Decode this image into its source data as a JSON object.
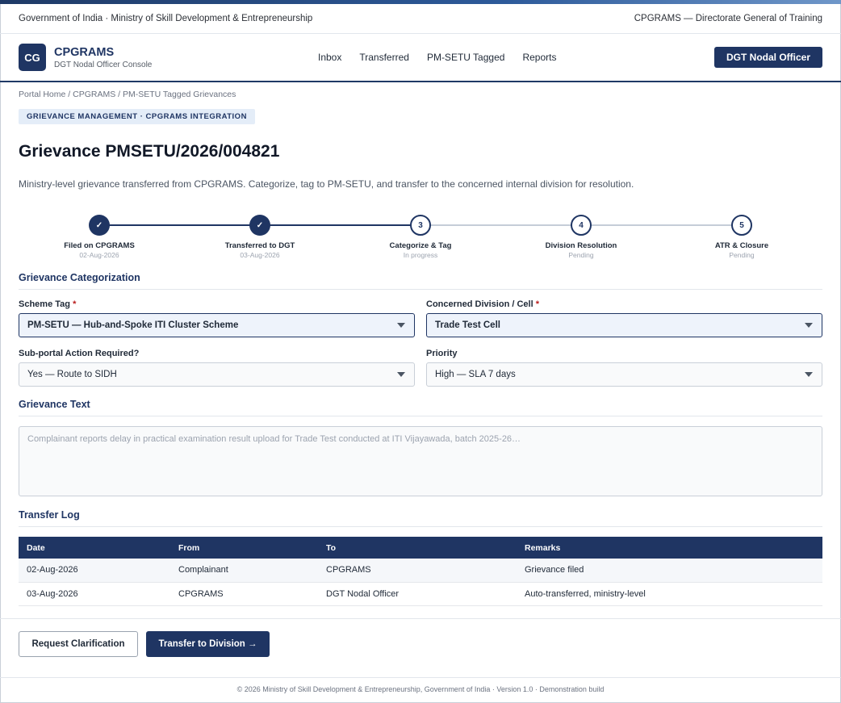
{
  "gov_bar": {
    "left": "Government of India · Ministry of Skill Development & Entrepreneurship",
    "right": "CPGRAMS — Directorate General of Training"
  },
  "header": {
    "logo_text": "CG",
    "title": "CPGRAMS",
    "subtitle": "DGT Nodal Officer Console",
    "nav": [
      "Inbox",
      "Transferred",
      "PM-SETU Tagged",
      "Reports"
    ],
    "role_button": "DGT Nodal Officer"
  },
  "breadcrumb": "Portal Home / CPGRAMS / PM-SETU Tagged Grievances",
  "section_chip": "GRIEVANCE MANAGEMENT · CPGRAMS INTEGRATION",
  "page_title": "Grievance PMSETU/2026/004821",
  "description": "Ministry-level grievance transferred from CPGRAMS. Categorize, tag to PM-SETU, and transfer to the concerned internal division for resolution.",
  "steps": [
    {
      "num": "✓",
      "label": "Filed on CPGRAMS",
      "sub": "02-Aug-2026",
      "state": "done"
    },
    {
      "num": "✓",
      "label": "Transferred to DGT",
      "sub": "03-Aug-2026",
      "state": "done"
    },
    {
      "num": "3",
      "label": "Categorize & Tag",
      "sub": "In progress",
      "state": "open"
    },
    {
      "num": "4",
      "label": "Division Resolution",
      "sub": "Pending",
      "state": "open"
    },
    {
      "num": "5",
      "label": "ATR & Closure",
      "sub": "Pending",
      "state": "open"
    }
  ],
  "categorization": {
    "heading": "Grievance Categorization",
    "scheme_label": "Scheme Tag",
    "scheme_value": "PM-SETU — Hub-and-Spoke ITI Cluster Scheme",
    "division_label": "Concerned Division / Cell",
    "division_value": "Trade Test Cell",
    "subportal_label": "Sub-portal Action Required?",
    "subportal_value": "Yes — Route to SIDH",
    "priority_label": "Priority",
    "priority_value": "High — SLA 7 days",
    "required_mark": "*"
  },
  "grievance_text": {
    "heading": "Grievance Text",
    "placeholder": "Complainant reports delay in practical examination result upload for Trade Test conducted at ITI Vijayawada, batch 2025-26…"
  },
  "transfer_log": {
    "heading": "Transfer Log",
    "columns": [
      "Date",
      "From",
      "To",
      "Remarks"
    ],
    "rows": [
      [
        "02-Aug-2026",
        "Complainant",
        "CPGRAMS",
        "Grievance filed"
      ],
      [
        "03-Aug-2026",
        "CPGRAMS",
        "DGT Nodal Officer",
        "Auto-transferred, ministry-level"
      ]
    ]
  },
  "actions": {
    "clarify": "Request Clarification",
    "transfer": "Transfer to Division →"
  },
  "footer": "© 2026 Ministry of Skill Development & Entrepreneurship, Government of India · Version 1.0 · Demonstration build",
  "colors": {
    "primary": "#1f3563",
    "chip_bg": "#e4edf8",
    "required": "#b91c1c"
  }
}
